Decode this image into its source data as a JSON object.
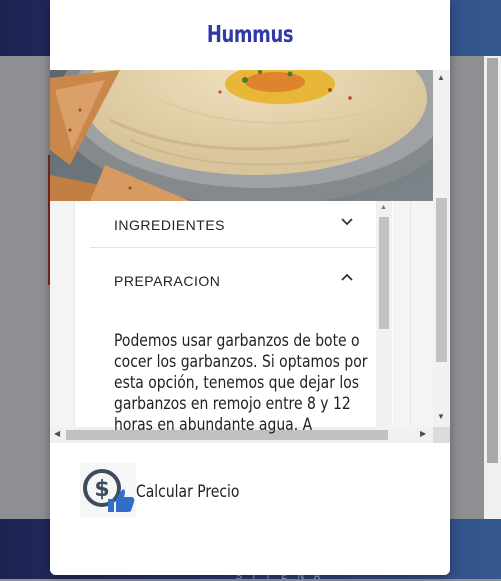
{
  "modal": {
    "title": "Hummus"
  },
  "accordion": {
    "items": [
      {
        "label": "INGREDIENTES",
        "state": "collapsed",
        "icon": "chevron-down-icon"
      },
      {
        "label": "PREPARACION",
        "state": "expanded",
        "icon": "chevron-up-icon"
      }
    ],
    "preparation_text": "Podemos usar garbanzos de bote o cocer los garbanzos. Si optamos por esta opción, tenemos que dejar los garbanzos en remojo entre 8 y 12 horas en abundante agua. A"
  },
  "footer": {
    "price_button_label": "Calcular Precio",
    "price_button_icon": "dollar-thumbs-up-icon"
  },
  "background": {
    "bottom_text": "S I T E N A"
  },
  "colors": {
    "title": "#2f3aa6",
    "header_bar": "#2d3a7a",
    "icon_blue": "#2f6fc9"
  }
}
